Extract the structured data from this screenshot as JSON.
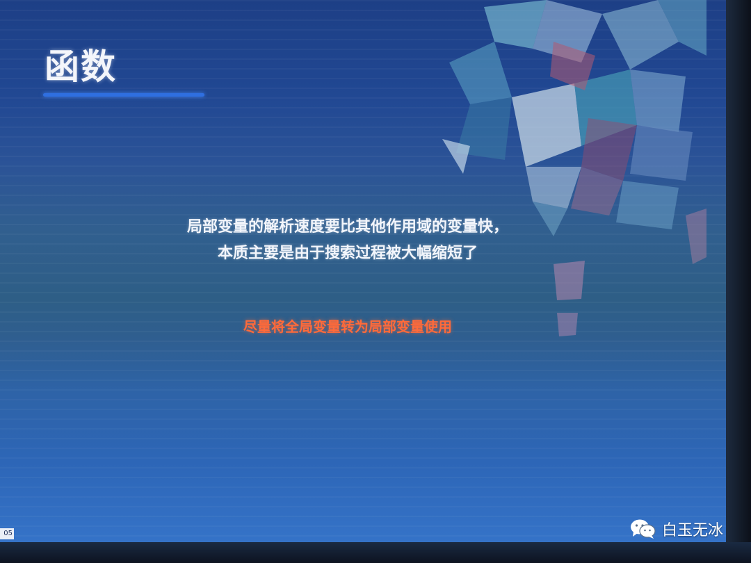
{
  "slide": {
    "title": "函数",
    "body_lines": [
      "局部变量的解析速度要比其他作用域的变量快，",
      "本质主要是由于搜索过程被大幅缩短了"
    ],
    "highlight": "尽量将全局变量转为局部变量使用",
    "corner_badge": "05"
  },
  "watermark": {
    "icon": "wechat-icon",
    "text": "白玉无冰"
  },
  "colors": {
    "title": "#f4f6fb",
    "underline": "#2f6fe0",
    "body": "#f2f5fb",
    "highlight": "#ff6a3a",
    "background_top": "#1d3f86",
    "background_bottom": "#3573c8"
  }
}
